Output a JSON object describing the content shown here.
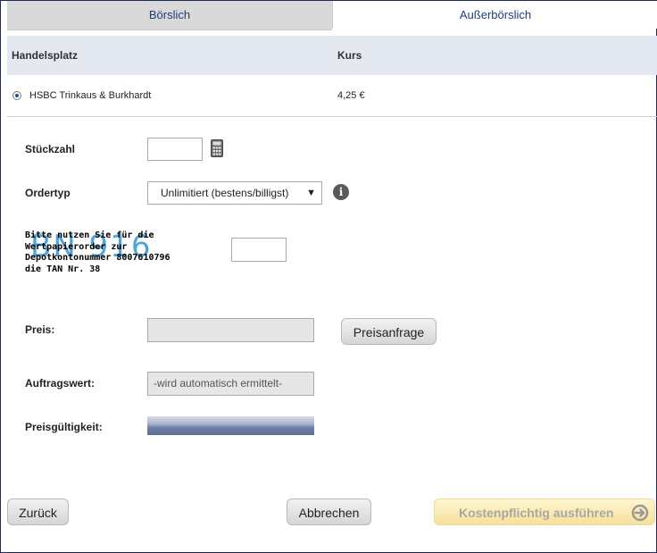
{
  "tabs": {
    "left": "Börslich",
    "right": "Außerbörslich"
  },
  "table": {
    "headers": [
      "Handelsplatz",
      "Kurs"
    ],
    "rows": [
      {
        "venue": "HSBC Trinkaus & Burkhardt",
        "price": "4,25 €"
      }
    ]
  },
  "form": {
    "quantity_label": "Stückzahl",
    "quantity_value": "",
    "ordertype_label": "Ordertyp",
    "ordertype_value": "Unlimitiert (bestens/billigst)",
    "tan_watermark": "BN 916",
    "tan_instruction": "Bitte nutzen Sie für die\nWertpapierorder zur\nDepotkontonummer 8007610796\ndie TAN Nr. 38",
    "tan_value": "",
    "price_label": "Preis:",
    "price_value": "",
    "price_request_button": "Preisanfrage",
    "order_value_label": "Auftragswert:",
    "order_value": "-wird automatisch ermittelt-",
    "validity_label": "Preisgültigkeit:",
    "validity_fraction": 1.0
  },
  "footer": {
    "back_button": "Zurück",
    "cancel_button": "Abbrechen",
    "execute_button": "Kostenpflichtig ausführen"
  },
  "icons": {
    "calculator": "calculator-icon",
    "info": "info-icon",
    "radio": "radio-selected-icon",
    "arrow": "arrow-right-circle-icon"
  },
  "colors": {
    "tab_text": "#1e3f7a",
    "watermark": "#3f9ad8",
    "primary_button": "#f6e09a"
  }
}
